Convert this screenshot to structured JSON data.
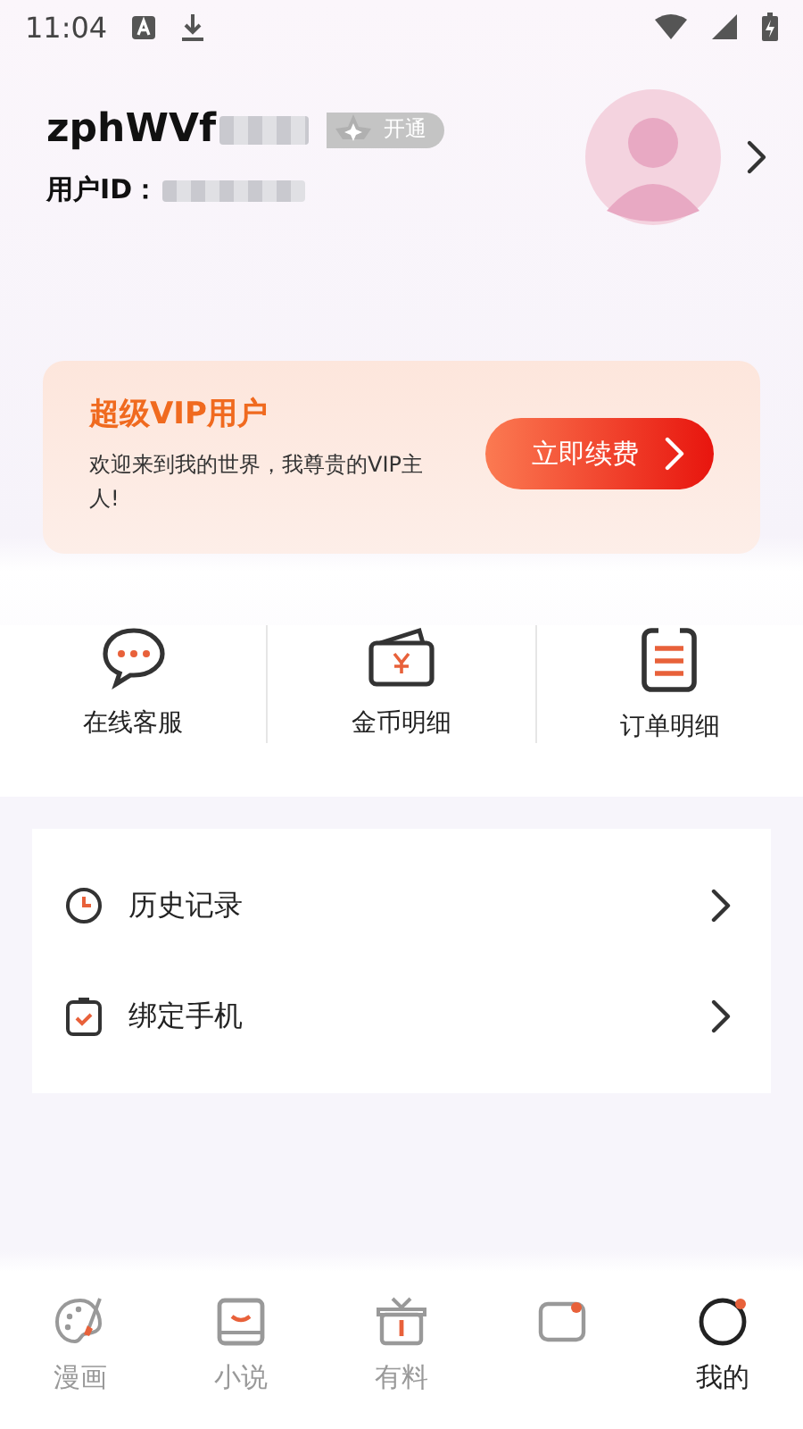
{
  "status_bar": {
    "time": "11:04"
  },
  "profile": {
    "username": "zphWVf",
    "vip_badge": "开通",
    "user_id_label": "用户ID："
  },
  "vip_card": {
    "title": "超级VIP用户",
    "message": "欢迎来到我的世界，我尊贵的VIP主人!",
    "button": "立即续费"
  },
  "quick_actions": [
    {
      "kind": "chat",
      "label": "在线客服"
    },
    {
      "kind": "wallet",
      "label": "金币明细"
    },
    {
      "kind": "orders",
      "label": "订单明细"
    }
  ],
  "menu": [
    {
      "kind": "history",
      "label": "历史记录"
    },
    {
      "kind": "phone",
      "label": "绑定手机"
    }
  ],
  "bottom_nav": [
    {
      "kind": "comics",
      "label": "漫画",
      "selected": false
    },
    {
      "kind": "novel",
      "label": "小说",
      "selected": false
    },
    {
      "kind": "gift",
      "label": "有料",
      "selected": false
    },
    {
      "kind": "game",
      "selected": false
    },
    {
      "kind": "me",
      "label": "我的",
      "selected": true
    }
  ]
}
